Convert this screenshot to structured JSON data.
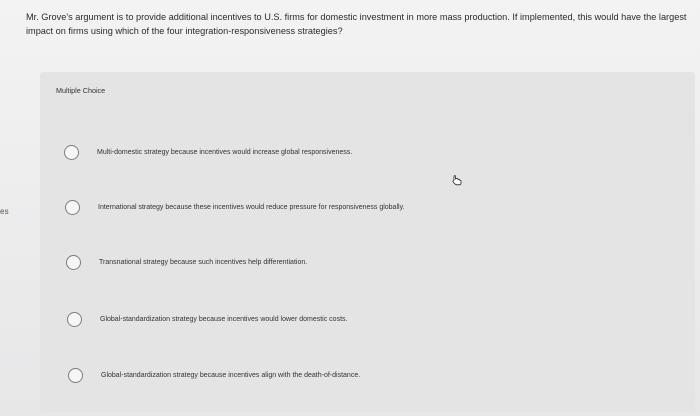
{
  "side_text": "es",
  "question": {
    "text": "Mr. Grove's argument is to provide additional incentives to U.S. firms for domestic investment in more mass production. If implemented, this would have the largest impact on firms using which of the four integration-responsiveness strategies?"
  },
  "panel": {
    "label": "Multiple Choice",
    "choices": [
      "Multi-domestic strategy because incentives would increase global responsiveness.",
      "International strategy because these incentives would reduce pressure for responsiveness globally.",
      "Transnational strategy because such incentives help differentiation.",
      "Global-standardization strategy because incentives would lower domestic costs.",
      "Global-standardization strategy because incentives align with the death-of-distance."
    ]
  }
}
